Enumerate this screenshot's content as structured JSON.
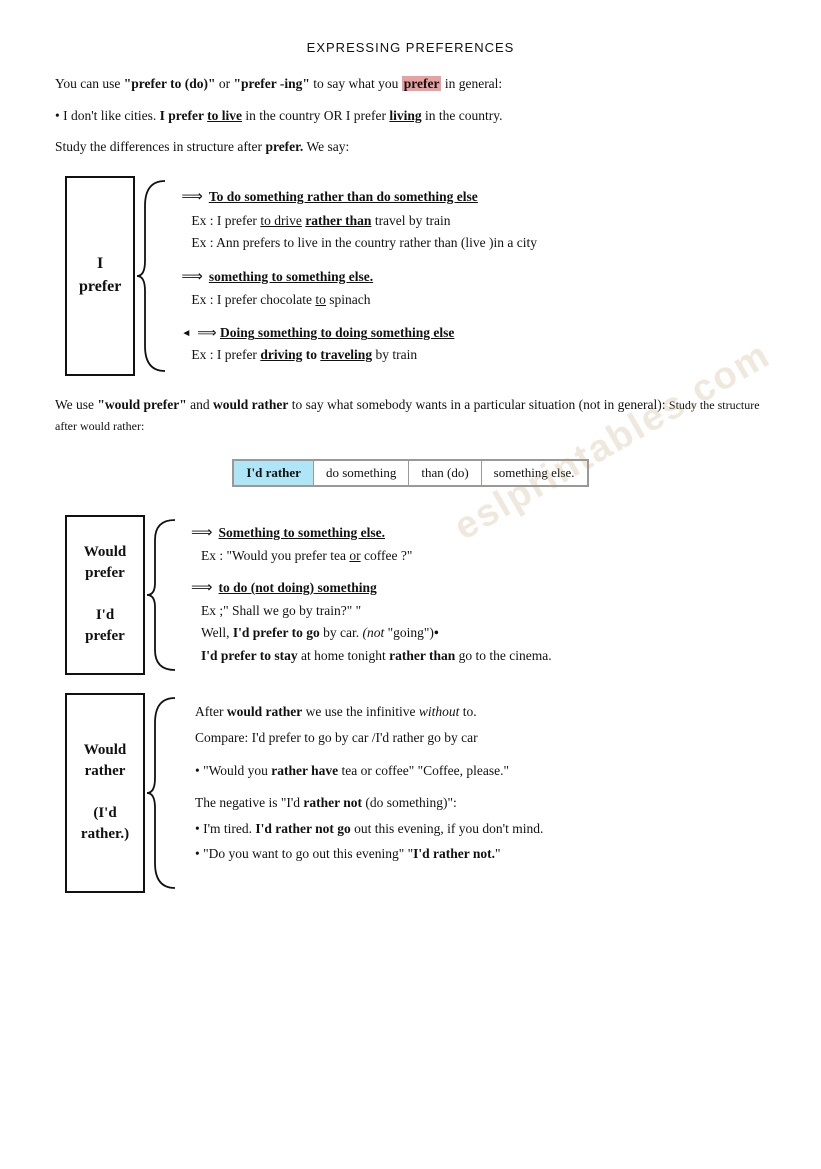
{
  "page": {
    "title": "EXPRESSING PREFERENCES",
    "intro": {
      "line1_pre": "You can use ",
      "line1_bold1": "\"prefer to (do)\"",
      "line1_mid": " or ",
      "line1_bold2": "\"prefer -ing\"",
      "line1_post": " to say what you ",
      "line1_highlight": "prefer",
      "line1_end": " in general:",
      "bullet": "• I don't like cities. I prefer to live in the country OR I prefer living in the country.",
      "study": "Study the differences in structure after prefer. We say:"
    },
    "i_prefer_box": "I prefer",
    "rules": [
      {
        "id": "rule1",
        "title": "To do something rather than do something else",
        "example1": "Ex : I prefer to drive rather than travel by train",
        "example2": "Ex : Ann prefers to live in the country rather than (live )in a city"
      },
      {
        "id": "rule2",
        "title": "something to something else.",
        "example1": "Ex : I prefer chocolate to spinach"
      },
      {
        "id": "rule3",
        "title": "Doing something to doing something else",
        "example1": "Ex : I prefer driving to traveling by train"
      }
    ],
    "would_section_intro": "We use \"would prefer\" and would rather to say what somebody wants in a particular situation (not in general): Study the structure after would rather:",
    "rather_table": {
      "cell1": "I'd rather",
      "cell2": "do something",
      "cell3": "than (do)",
      "cell4": "something else."
    },
    "would_prefer_box": "Would prefer\n\nI'd prefer",
    "would_prefer_rules": [
      {
        "id": "wp1",
        "title": "Something to something else.",
        "example": "Ex : \"Would you prefer tea or coffee ?\""
      },
      {
        "id": "wp2",
        "title": "to do (not doing) something",
        "example1": "Ex ;\" Shall we go by train?\" \"",
        "example2": "Well, I'd prefer to go by car. (not \"going\")•",
        "example3": "I'd prefer to stay at home tonight rather than go to the cinema."
      }
    ],
    "would_rather_box": "Would rather\n\n(I'd rather.)",
    "would_rather_content": {
      "line1": "After would rather we use the infinitive without to.",
      "line2": "Compare:  I'd prefer to go by car /I'd rather go by car",
      "bullet1": "\"Would you rather have tea or coffee\" \"Coffee, please.\"",
      "negative_intro": "The negative is \"I'd rather not (do something)\":",
      "neg1": "• I'm tired. I'd rather not go out this evening, if you don't mind.",
      "neg2": "• \"Do you want to go out this evening\" \"I'd rather not.\""
    }
  }
}
